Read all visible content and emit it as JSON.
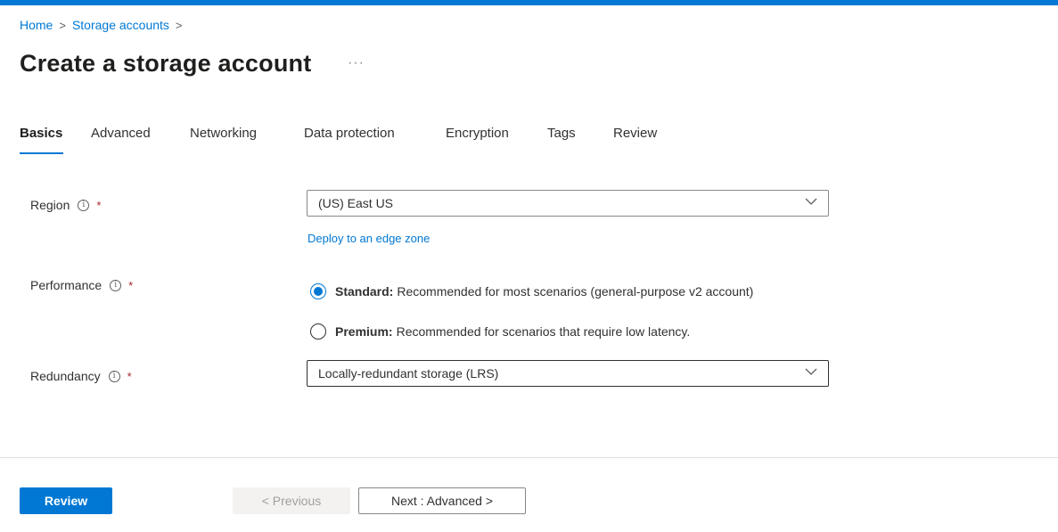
{
  "breadcrumb": {
    "items": [
      "Home",
      "Storage accounts"
    ],
    "separator": ">"
  },
  "page": {
    "title": "Create a storage account",
    "more": "···"
  },
  "tabs": [
    {
      "label": "Basics",
      "active": true
    },
    {
      "label": "Advanced",
      "active": false
    },
    {
      "label": "Networking",
      "active": false
    },
    {
      "label": "Data protection",
      "active": false
    },
    {
      "label": "Encryption",
      "active": false
    },
    {
      "label": "Tags",
      "active": false
    },
    {
      "label": "Review",
      "active": false
    }
  ],
  "form": {
    "info_glyph": "i",
    "required_mark": "*",
    "region": {
      "label": "Region",
      "value": "(US) East US",
      "link": "Deploy to an edge zone"
    },
    "performance": {
      "label": "Performance",
      "options": [
        {
          "title": "Standard:",
          "description": "Recommended for most scenarios (general-purpose v2 account)",
          "selected": true
        },
        {
          "title": "Premium:",
          "description": "Recommended for scenarios that require low latency.",
          "selected": false
        }
      ]
    },
    "redundancy": {
      "label": "Redundancy",
      "value": "Locally-redundant storage (LRS)"
    }
  },
  "footer": {
    "review": "Review",
    "previous": "< Previous",
    "next": "Next : Advanced >"
  },
  "colors": {
    "accent": "#0078d4",
    "required": "#a4262c",
    "text": "#323130"
  }
}
